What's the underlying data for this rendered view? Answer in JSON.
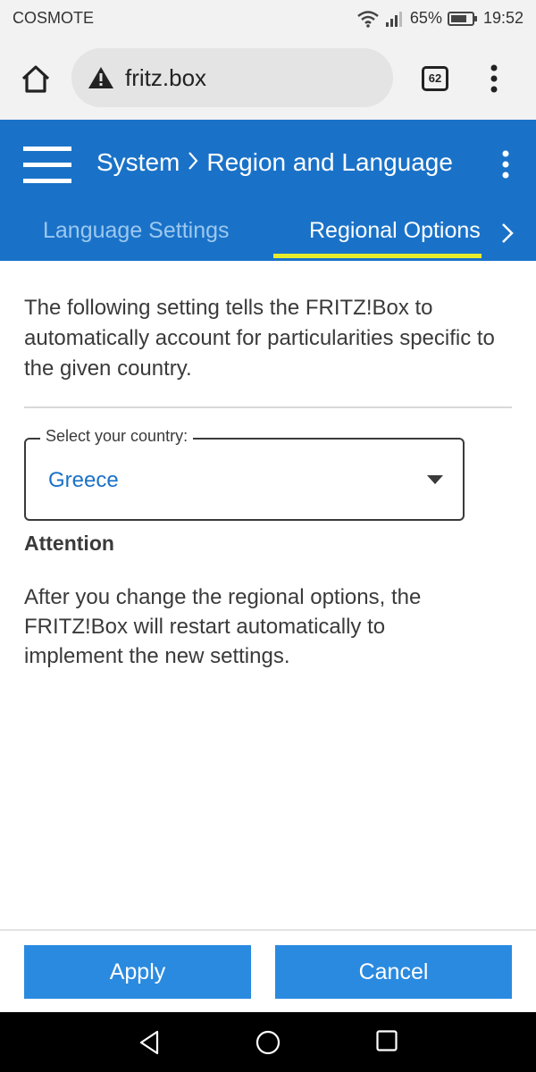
{
  "status_bar": {
    "carrier": "COSMOTE",
    "battery": "65%",
    "time": "19:52"
  },
  "browser": {
    "url": "fritz.box",
    "tab_count": "62",
    "icons": [
      "home-icon",
      "warning-icon",
      "tabs-icon",
      "more-vert-icon"
    ]
  },
  "header": {
    "breadcrumb_parent": "System",
    "breadcrumb_current": "Region and Language",
    "tabs": [
      {
        "label": "Language Settings",
        "active": false
      },
      {
        "label": "Regional Options",
        "active": true
      }
    ],
    "accent_color": "#1a72c8",
    "tab_underline_color": "#e8ec2a"
  },
  "content": {
    "intro": "The following setting tells the FRITZ!Box to automatically account for particularities specific to the given country.",
    "country_select": {
      "label": "Select your country:",
      "value": "Greece"
    },
    "attention_title": "Attention",
    "attention_text": "After you change the regional options, the FRITZ!Box will restart automatically to implement the new settings."
  },
  "footer": {
    "apply_label": "Apply",
    "cancel_label": "Cancel",
    "button_color": "#2a8ae0"
  }
}
